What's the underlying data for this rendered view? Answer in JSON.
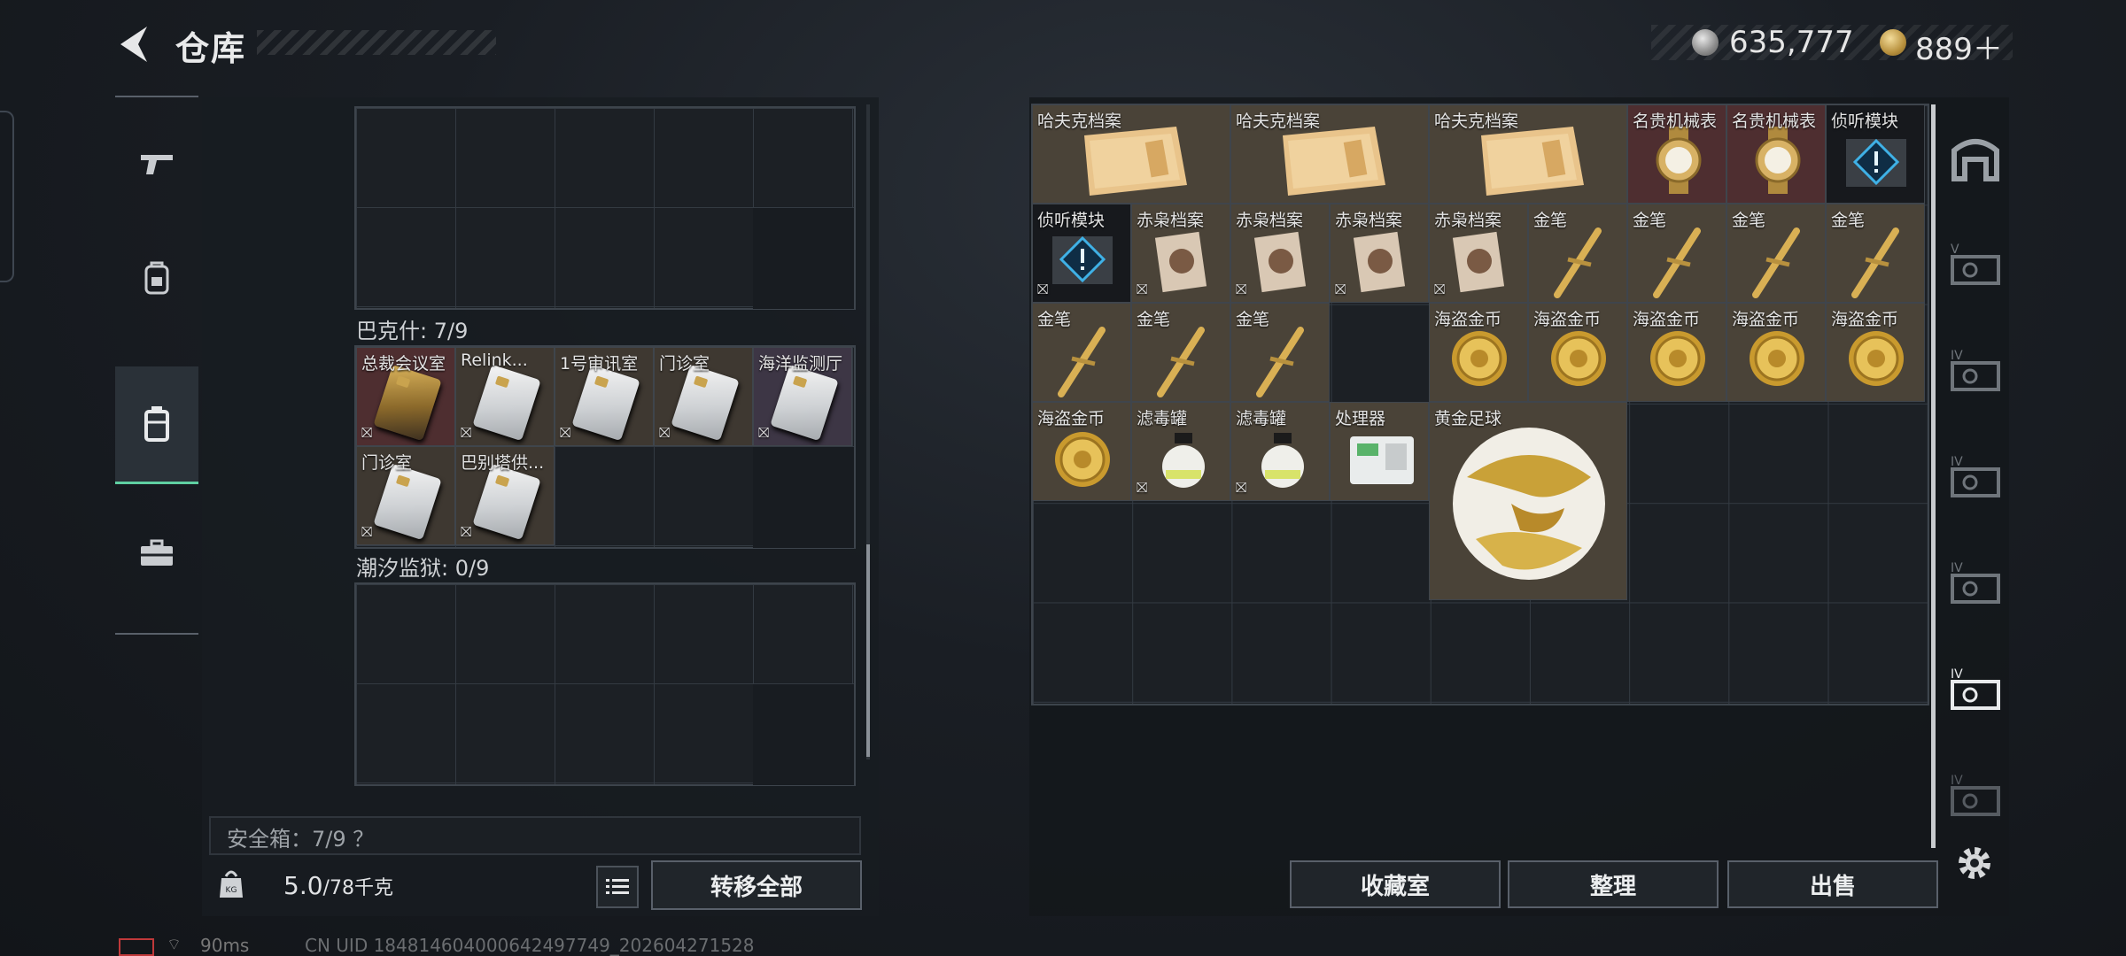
{
  "header": {
    "title": "仓库",
    "silver_amount": "635,777",
    "gold_amount": "889＋"
  },
  "colors": {
    "accent_green": "#5fd0a2",
    "gold": "#c9a34e"
  },
  "nav": {
    "items": [
      {
        "icon": "gun-icon",
        "active": false
      },
      {
        "icon": "backpack-icon",
        "active": false
      },
      {
        "icon": "case-icon",
        "active": true
      },
      {
        "icon": "toolbox-icon",
        "active": false
      }
    ]
  },
  "left_panel": {
    "sections": [
      {
        "title": "巴克什: 7/9",
        "cards": [
          "总裁会议室",
          "Relink...",
          "1号审讯室",
          "门诊室",
          "海洋监测厅",
          "门诊室",
          "巴别塔供..."
        ]
      },
      {
        "title": "潮汐监狱: 0/9",
        "cards": []
      }
    ],
    "safebox_label": "安全箱：7/9 ？",
    "weight": {
      "current": "5.0",
      "max": "/78千克"
    },
    "transfer_all": "转移全部"
  },
  "stash": {
    "items": [
      {
        "name": "哈夫克档案"
      },
      {
        "name": "哈夫克档案"
      },
      {
        "name": "哈夫克档案"
      },
      {
        "name": "名贵机械表"
      },
      {
        "name": "名贵机械表"
      },
      {
        "name": "侦听模块"
      },
      {
        "name": "侦听模块"
      },
      {
        "name": "赤枭档案"
      },
      {
        "name": "赤枭档案"
      },
      {
        "name": "赤枭档案"
      },
      {
        "name": "赤枭档案"
      },
      {
        "name": "金笔"
      },
      {
        "name": "金笔"
      },
      {
        "name": "金笔"
      },
      {
        "name": "金笔"
      },
      {
        "name": "金笔"
      },
      {
        "name": "金笔"
      },
      {
        "name": "金笔"
      },
      {
        "name": "海盗金币"
      },
      {
        "name": "海盗金币"
      },
      {
        "name": "海盗金币"
      },
      {
        "name": "海盗金币"
      },
      {
        "name": "海盗金币"
      },
      {
        "name": "海盗金币"
      },
      {
        "name": "滤毒罐"
      },
      {
        "name": "滤毒罐"
      },
      {
        "name": "处理器"
      },
      {
        "name": "黄金足球"
      }
    ],
    "buttons": {
      "collection": "收藏室",
      "sort": "整理",
      "sell": "出售"
    },
    "tabs": [
      "home-tab-icon",
      "case-tier-tab-icon",
      "case-tier-tab-icon",
      "case-tier-tab-icon",
      "case-tier-tab-icon",
      "case-tier-tab-icon",
      "case-tier-tab-icon"
    ]
  },
  "footer": {
    "ping": "90ms",
    "uid": "CN UID 184814604000642497749_202604271528"
  }
}
